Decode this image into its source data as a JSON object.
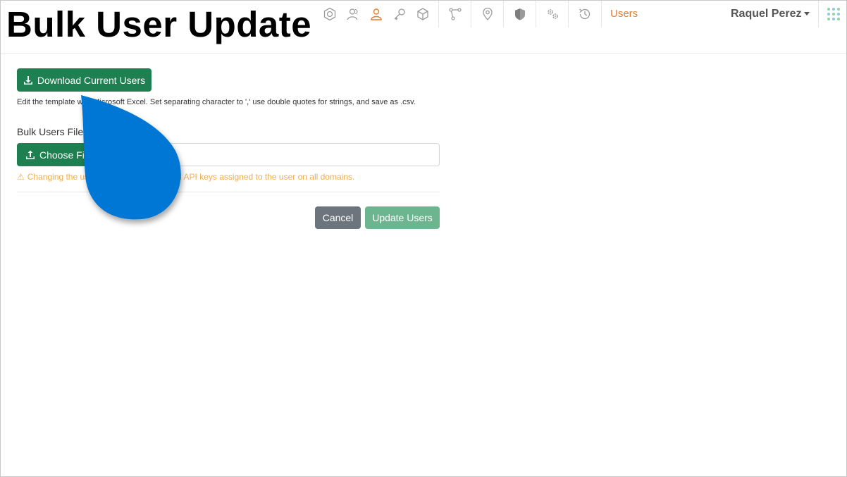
{
  "header": {
    "page_title": "Bulk User Update",
    "active_section": "Users",
    "user_name": "Raquel Perez"
  },
  "nav_icons": [
    "hexagon-icon",
    "users-icon",
    "user-icon",
    "key-icon",
    "cube-icon",
    "branch-icon",
    "location-pin-icon",
    "shield-icon",
    "gears-icon",
    "history-icon"
  ],
  "form": {
    "download_label": "Download Current Users",
    "help_text": "Edit the template with Microsoft Excel. Set separating character to ',' use double quotes for strings, and save as .csv.",
    "field_label": "Bulk Users File",
    "choose_label": "Choose File",
    "file_value": "",
    "warning_text": "Changing the user's role will invalidate all API keys assigned to the user on all domains.",
    "cancel_label": "Cancel",
    "update_label": "Update Users"
  },
  "colors": {
    "primary_green": "#1e8050",
    "disabled_green": "#6db58f",
    "cancel_gray": "#6c757d",
    "accent_orange": "#e87d2e",
    "warning_yellow": "#f0ad4e",
    "pointer_blue": "#0077d4"
  }
}
